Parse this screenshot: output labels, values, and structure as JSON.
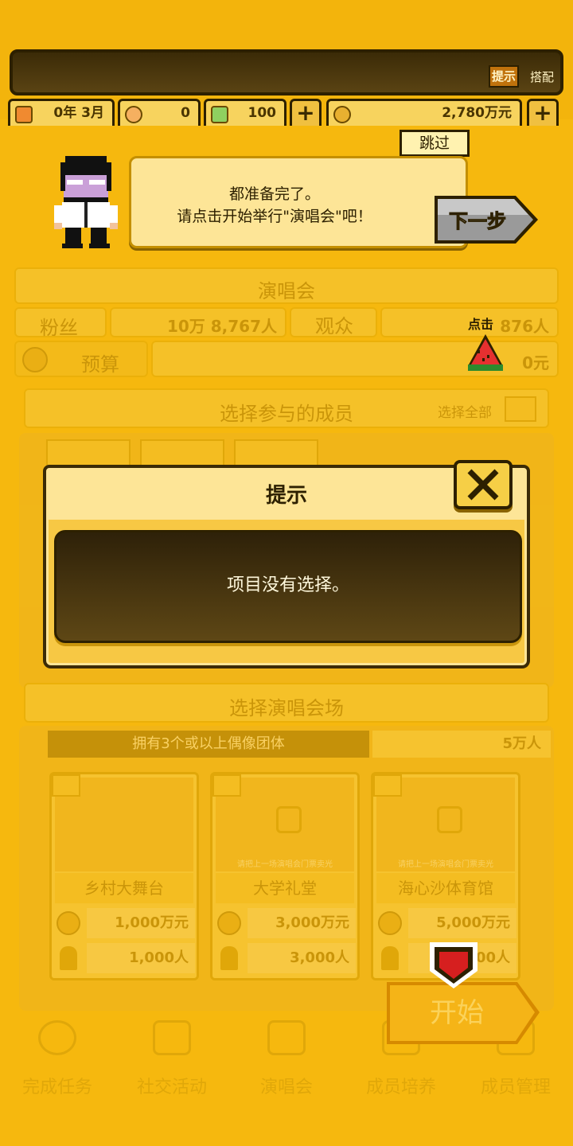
{
  "header": {
    "tip_label": "提示",
    "match_label": "搭配",
    "stats": [
      {
        "icon": "calendar-icon",
        "value": "0年 3月"
      },
      {
        "icon": "ticket-icon",
        "value": "0"
      },
      {
        "icon": "gem-icon",
        "value": "100"
      },
      {
        "icon": "coin-icon",
        "value": "2,780万元"
      }
    ]
  },
  "tutorial": {
    "skip_label": "跳过",
    "line1": "都准备完了。",
    "line2": "请点击开始举行\"演唱会\"吧！",
    "next_label": "下一步"
  },
  "concert": {
    "title": "演唱会",
    "fans_label": "粉丝",
    "fans_value": "10万 8,767人",
    "audience_label": "观众",
    "audience_value": "876人",
    "tap_label": "点击",
    "budget_label": "预算",
    "budget_value": "0元",
    "members_header": "选择参与的成员",
    "select_all_label": "选择全部",
    "venue_header": "选择演唱会场",
    "venue_requirement": "拥有3个或以上偶像团体",
    "venue_capacity_top": "5万人",
    "venues": [
      {
        "name": "乡村大舞台",
        "cost": "1,000万元",
        "capacity": "1,000人",
        "locked": false,
        "note": ""
      },
      {
        "name": "大学礼堂",
        "cost": "3,000万元",
        "capacity": "3,000人",
        "locked": true,
        "note": "请把上一场演唱会门票卖光"
      },
      {
        "name": "海心沙体育馆",
        "cost": "5,000万元",
        "capacity": "5,000人",
        "locked": true,
        "note": "请把上一场演唱会门票卖光"
      }
    ],
    "start_label": "开始"
  },
  "bottom_nav": [
    "完成任务",
    "社交活动",
    "演唱会",
    "成员培养",
    "成员管理"
  ],
  "modal": {
    "title": "提示",
    "message": "项目没有选择。"
  }
}
